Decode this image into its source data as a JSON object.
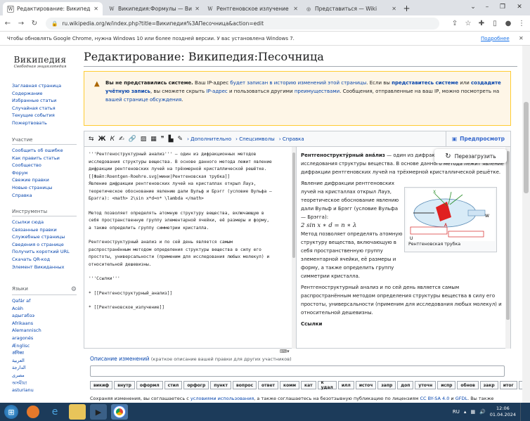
{
  "browser": {
    "tabs": [
      {
        "title": "Редактирование: Википедия:П",
        "fav": "W",
        "active": true
      },
      {
        "title": "Википедия:Формулы — Википе",
        "fav": "W",
        "active": false
      },
      {
        "title": "Рентгеновское излучение — Ви",
        "fav": "W",
        "active": false
      },
      {
        "title": "Представиться — Wiki",
        "fav": "◎",
        "active": false
      }
    ],
    "url": "ru.wikipedia.org/w/index.php?title=Википедия%3AПесочница&action=edit",
    "infobar": "Чтобы обновлять Google Chrome, нужна Windows 10 или более поздней версии. У вас установлена Windows 7.",
    "infobar_link": "Подробнее"
  },
  "logo": {
    "title": "Википедия",
    "tagline": "Свободная энциклопедия"
  },
  "sidebar": {
    "nav": [
      "Заглавная страница",
      "Содержание",
      "Избранные статьи",
      "Случайная статья",
      "Текущие события",
      "Пожертвовать"
    ],
    "participation_h": "Участие",
    "participation": [
      "Сообщить об ошибке",
      "Как править статьи",
      "Сообщество",
      "Форум",
      "Свежие правки",
      "Новые страницы",
      "Справка"
    ],
    "tools_h": "Инструменты",
    "tools": [
      "Ссылки сюда",
      "Связанные правки",
      "Служебные страницы",
      "Сведения о странице",
      "Получить короткий URL",
      "Скачать QR-код",
      "Элемент Викиданных"
    ],
    "lang_h": "Языки",
    "langs": [
      "Qafár af",
      "Acèh",
      "адыгабзэ",
      "Afrikaans",
      "Alemannisch",
      "aragonés",
      "Ænglisc",
      "अंगिका",
      "العربية",
      "الدارجة",
      "مصرى",
      "অসমীয়া",
      "asturianu"
    ]
  },
  "page": {
    "title": "Редактирование: Википедия:Песочница"
  },
  "warning": {
    "bold": "Вы не представились системе.",
    "t1": " Ваш IP-адрес ",
    "l1": "будет записан в историю изменений этой страницы",
    "t2": ". Если вы ",
    "l2": "представитесь системе",
    "t3": " или ",
    "l3": "создадите учётную запись",
    "t4": ", вы сможете скрыть ",
    "l4": "IP-адрес",
    "t5": " и пользоваться другими ",
    "l5": "преимуществами",
    "t6": ". Сообщения, отправленные на ваш IP, можно посмотреть на ",
    "l6": "вашей странице обсуждения",
    "t7": "."
  },
  "toolbar": {
    "advanced": "Дополнительно",
    "special": "Спецсимволы",
    "help": "Справка",
    "preview": "Предпросмотр"
  },
  "editor": {
    "lines": [
      "'''Рентгеноструктурный анализ''' — один из дифракционных методов",
      "исследования структуры вещества. В основе данного метода лежит явление",
      "дифракции рентгеновских лучей на трёхмерной кристаллической решётке.",
      "[[Файл:Roentgen-Roehre.svg|мини|Рентгеновская трубка]]",
      "Явление дифракции рентгеновских лучей на кристаллах открыл Лауэ,",
      "теоретическое обоснование явлению дали Вульф и Брэгг (условие Вульфа —",
      "Брэгга): <math> 2\\sin x*d=n* \\lambda </math>",
      "",
      "Метод позволяет определять атомную структуру вещества, включающую в",
      "себя пространственную группу элементарной ячейки, её размеры и форму,",
      "а также определить группу симметрии кристалла.",
      "",
      "Рентгеноструктурный анализ и по сей день является самым",
      "распространённым методом определения структуры вещества в силу его",
      "простоты, универсальности (применим для исследования любых молекул) и",
      "относительной дешевизны.",
      "",
      "'''Ссылки'''",
      "",
      "* [[Рентгеноструктурный_анализ]]",
      "",
      "* [[Рентгеновское_излучение]]"
    ]
  },
  "preview": {
    "reload": "Перезагрузить",
    "p1_bold": "Рентгенострукту́рный ана́лиз",
    "p1": " — один из дифракционных методов исследования структуры вещества. В основе данного метода лежит явление дифракции рентгеновских лучей на трёхмерной кристаллической решётке.",
    "p2": "Явление дифракции рентгеновских лучей на кристаллах открыл Лауэ, теоретическое обоснование явлению дали Вульф и Брэгг (условие Вульфа — Брэгга):",
    "formula": "2 sin x ∗ d = n ∗ λ",
    "p3": "Метод позволяет определять атомную структуру вещества, включающую в себя пространственную группу элементарной ячейки, её размеры и форму, а также определить группу симметрии кристалла.",
    "p4": "Рентгеноструктурный анализ и по сей день является самым распространённым методом определения структуры вещества в силу его простоты, универсальности (применим для исследования любых молекул) и относительной дешевизны.",
    "h": "Ссылки",
    "fig_caption": "Рентгеновская трубка"
  },
  "summary": {
    "label": "Описание изменений",
    "hint": "(краткое описание вашей правки для других участников)"
  },
  "chars": [
    "викиф",
    "внутр",
    "оформл",
    "стил",
    "орфогр",
    "пункт",
    "вопрос",
    "ответ",
    "комм",
    "кат",
    "к удал",
    "илл",
    "источ",
    "запр",
    "доп",
    "уточн",
    "испр",
    "обнов",
    "закр",
    "итог",
    "?"
  ],
  "legal": {
    "t1": "Сохраняя изменения, вы соглашаетесь с ",
    "l1": "условиями использования",
    "t2": ", а также соглашаетесь на безотзывную публикацию по лицензиям ",
    "l2": "CC BY-SA 4.0",
    "t3": " и ",
    "l3": "GFDL",
    "t4": ". Вы также"
  },
  "taskbar": {
    "lang": "RU",
    "time": "12:06",
    "date": "01.04.2024"
  }
}
